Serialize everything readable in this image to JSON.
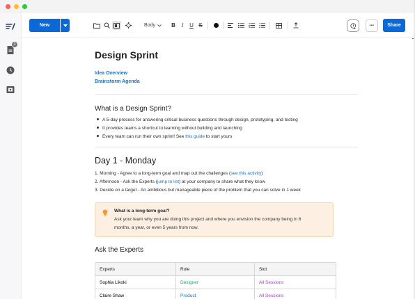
{
  "toolbar": {
    "new_label": "New",
    "text_style": "Body",
    "share_label": "Share",
    "more_label": "•••"
  },
  "rail": {
    "docs_badge": "3"
  },
  "doc": {
    "title": "Design Sprint",
    "toc": [
      "Idea Overview",
      "Brainstorm Agenda"
    ],
    "section1": {
      "heading": "What is a Design Sprint?",
      "bullets": [
        "A 5-day process for answering critical business questions through design, prototyping, and testing",
        "It provides teams a shortcut to learning without building and launching",
        "Every team can run their own sprint! See ",
        "this guide",
        " to start yours"
      ]
    },
    "section2": {
      "heading": "Day 1 - Monday",
      "item1_text": "1. Morning - Agree to a long-term goal and map out the challenges (",
      "item1_link": "see this activity",
      "item1_end": ")",
      "item2_text": "2. Afternoon - Ask the Experts (",
      "item2_link": "jump to list",
      "item2_end": ") at your company to share what they know",
      "item3_text": "3. Decide on a target - An ambitious but manageable piece of the problem that you can solve in 1 week"
    },
    "callout": {
      "title": "What is a long-term goal?",
      "line1": "Ask your team why you are doing this project and where you envision the company being in 6",
      "line2": "months, a year, or even 5 years from now."
    },
    "section3": {
      "heading": "Ask the Experts"
    },
    "table": {
      "headers": [
        "Experts",
        "Role",
        "Slot"
      ],
      "rows": [
        [
          "Sophia Likoki",
          "Designer",
          "All Sessions"
        ],
        [
          "Claire Shaw",
          "Product",
          "All Sessions"
        ]
      ]
    }
  },
  "colors": {
    "accent": "#0b68d8",
    "link": "#1a6fd8",
    "designer": "#1fa36b",
    "slot": "#9b3ad6",
    "callout_bg": "#fdf0e2"
  }
}
